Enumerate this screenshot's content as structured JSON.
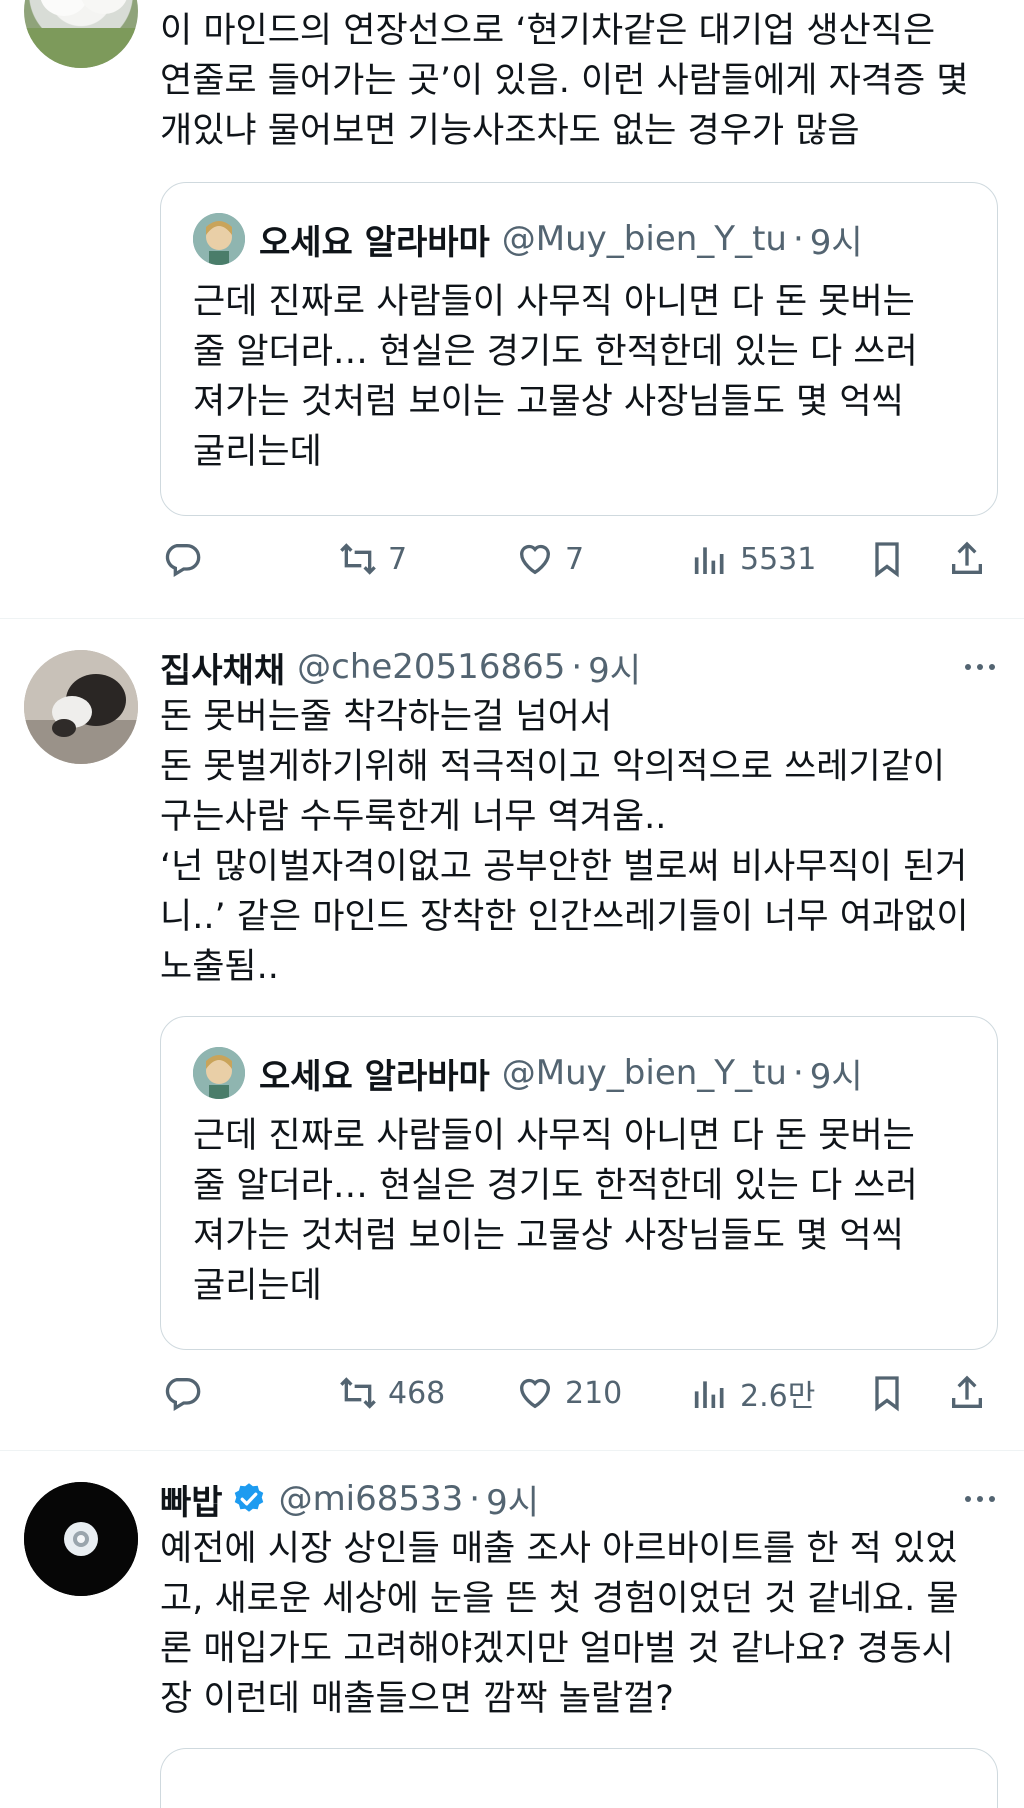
{
  "tweets": [
    {
      "text_lines": [
        "이 마인드의 연장선으로 ‘현기차같은 대기업 생산직은",
        "연줄로 들어가는 곳’이 있음. 이런 사람들에게 자격증 몇",
        "개있냐 물어보면 기능사조차도 없는 경우가 많음"
      ],
      "quote": {
        "name": "오세요 알라바마",
        "handle": "@Muy_bien_Y_tu",
        "sep": "·",
        "time": "9시",
        "lines": [
          "근데 진짜로 사람들이 사무직 아니면 다 돈 못버는",
          "줄 알더라… 현실은 경기도 한적한데 있는 다 쓰러",
          "져가는 것처럼 보이는 고물상 사장님들도 몇 억씩",
          "굴리는데"
        ]
      },
      "actions": {
        "retweets": "7",
        "likes": "7",
        "views": "5531"
      }
    },
    {
      "name": "집사채채",
      "handle": "@che20516865",
      "sep": "·",
      "time": "9시",
      "text_lines": [
        "돈 못버는줄 착각하는걸 넘어서",
        "돈 못벌게하기위해 적극적이고 악의적으로 쓰레기같이",
        "구는사람 수두룩한게 너무 역겨움..",
        "‘넌 많이벌자격이없고 공부안한 벌로써 비사무직이 된거",
        "니..’ 같은 마인드 장착한 인간쓰레기들이 너무 여과없이",
        "노출됨.."
      ],
      "quote": {
        "name": "오세요 알라바마",
        "handle": "@Muy_bien_Y_tu",
        "sep": "·",
        "time": "9시",
        "lines": [
          "근데 진짜로 사람들이 사무직 아니면 다 돈 못버는",
          "줄 알더라… 현실은 경기도 한적한데 있는 다 쓰러",
          "져가는 것처럼 보이는 고물상 사장님들도 몇 억씩",
          "굴리는데"
        ]
      },
      "actions": {
        "retweets": "468",
        "likes": "210",
        "views": "2.6만"
      }
    },
    {
      "name": "빠밥",
      "handle": "@mi68533",
      "sep": "·",
      "time": "9시",
      "verified": true,
      "text_lines": [
        "예전에 시장 상인들 매출 조사 아르바이트를 한 적 있었",
        "고, 새로운 세상에 눈을 뜬 첫 경험이었던 것 같네요. 물",
        "론 매입가도 고려해야겠지만 얼마벌 것 같나요? 경동시",
        "장 이런데 매출들으면 깜짝 놀랄껄?"
      ]
    }
  ],
  "colors": {
    "text": "#0f1419",
    "secondary": "#536471",
    "border": "#cfd9de",
    "verified": "#1d9bf0"
  },
  "icons": [
    "reply-icon",
    "retweet-icon",
    "like-icon",
    "views-icon",
    "bookmark-icon",
    "share-icon",
    "more-icon",
    "verified-icon"
  ]
}
